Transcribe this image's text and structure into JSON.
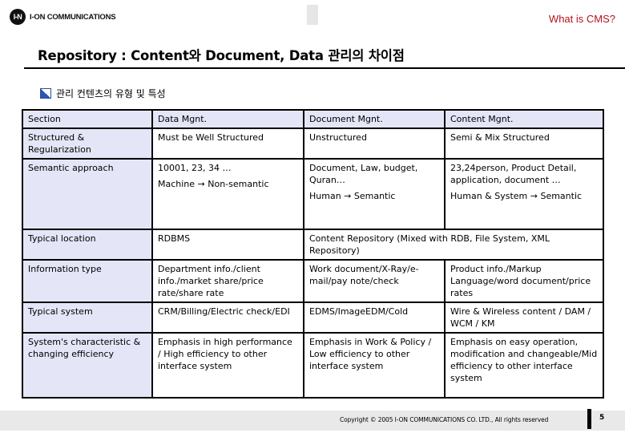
{
  "header": {
    "logo_mark": "I-N",
    "logo_text": "I-ON COMMUNICATIONS",
    "link": "What is CMS?"
  },
  "title": "Repository : Content와 Document, Data 관리의 차이점",
  "subheading": {
    "icon": "blue-square-bullet-icon",
    "text": "관리 컨텐츠의 유형 및 특성"
  },
  "table": {
    "headers": [
      "Section",
      "Data Mgnt.",
      "Document Mgnt.",
      "Content Mgnt."
    ],
    "rows": [
      {
        "section": "Structured & Regularization",
        "data": [
          "Must be Well Structured"
        ],
        "document": [
          "Unstructured"
        ],
        "content": [
          "Semi & Mix Structured"
        ]
      },
      {
        "section": "Semantic approach",
        "data": [
          "10001, 23, 34 …",
          "Machine → Non-semantic"
        ],
        "document": [
          "Document, Law, budget, Quran…",
          "Human → Semantic"
        ],
        "content": [
          "23,24person, Product Detail, application, document …",
          "Human & System → Semantic"
        ]
      },
      {
        "section": "Typical location",
        "data": [
          "RDBMS"
        ],
        "merged": "Content Repository (Mixed with RDB, File System, XML Repository)"
      },
      {
        "section": "Information type",
        "data": [
          "Department info./client info./market share/price rate/share rate"
        ],
        "document": [
          "Work document/X-Ray/e-mail/pay note/check"
        ],
        "content": [
          "Product info./Markup Language/word document/price rates"
        ]
      },
      {
        "section": "Typical system",
        "data": [
          "CRM/Billing/Electric check/EDI"
        ],
        "document": [
          "EDMS/ImageEDM/Cold"
        ],
        "content": [
          "Wire & Wireless content / DAM / WCM / KM"
        ]
      },
      {
        "section": "System's characteristic & changing efficiency",
        "data": [
          "Emphasis in high performance / High efficiency to other interface system"
        ],
        "document": [
          "Emphasis in Work & Policy / Low efficiency to other interface system"
        ],
        "content": [
          "Emphasis on easy operation, modification and changeable/Mid efficiency to other interface system"
        ]
      }
    ]
  },
  "footer": {
    "copyright": "Copyright © 2005 I-ON COMMUNICATIONS CO. LTD., All rights reserved",
    "page_number": "5"
  },
  "colors": {
    "accent_link": "#b4121b",
    "section_bg": "#e4e6f8",
    "footer_bg": "#e9e9e9"
  }
}
